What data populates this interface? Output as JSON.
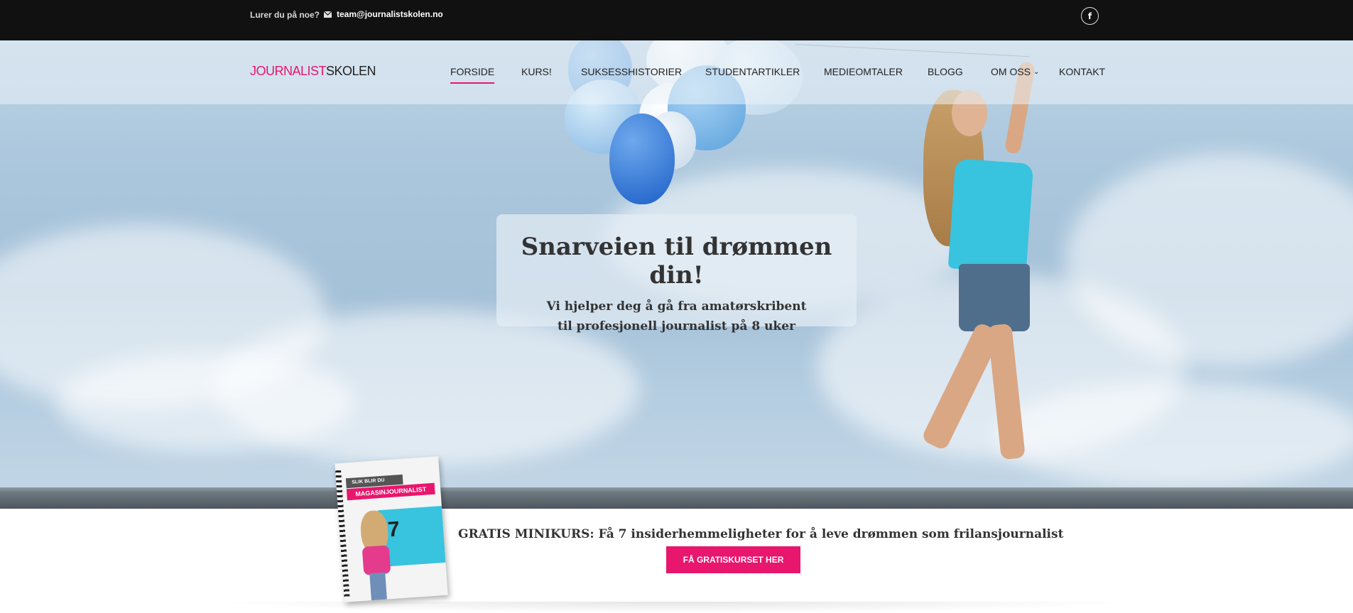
{
  "topbar": {
    "question": "Lurer du på noe?",
    "email": "team@journalistskolen.no",
    "email_icon": "envelope-icon",
    "facebook_icon": "facebook-icon",
    "facebook_glyph": "f"
  },
  "header": {
    "logo_part1": "JOURNALIST",
    "logo_part2": "SKOLEN",
    "nav": [
      {
        "label": "FORSIDE",
        "active": true
      },
      {
        "label": "KURS!"
      },
      {
        "label": "SUKSESSHISTORIER"
      },
      {
        "label": "STUDENTARTIKLER"
      },
      {
        "label": "MEDIEOMTALER"
      },
      {
        "label": "BLOGG"
      },
      {
        "label": "OM OSS",
        "dropdown": true
      },
      {
        "label": "KONTAKT"
      }
    ]
  },
  "hero": {
    "title": "Snarveien til drømmen din!",
    "subtitle_line1": "Vi hjelper deg å gå fra amatørskribent",
    "subtitle_line2": "til profesjonell journalist på 8 uker"
  },
  "promo": {
    "text": "GRATIS MINIKURS: Få 7 insiderhemmeligheter for å leve drømmen som frilansjournalist",
    "button": "FÅ GRATISKURSET HER",
    "book": {
      "line1": "SLIK BLIR DU",
      "line2": "MAGASINJOURNALIST",
      "number": "7"
    }
  },
  "colors": {
    "accent": "#e8166c",
    "topbar": "#111111",
    "text": "#333333"
  }
}
